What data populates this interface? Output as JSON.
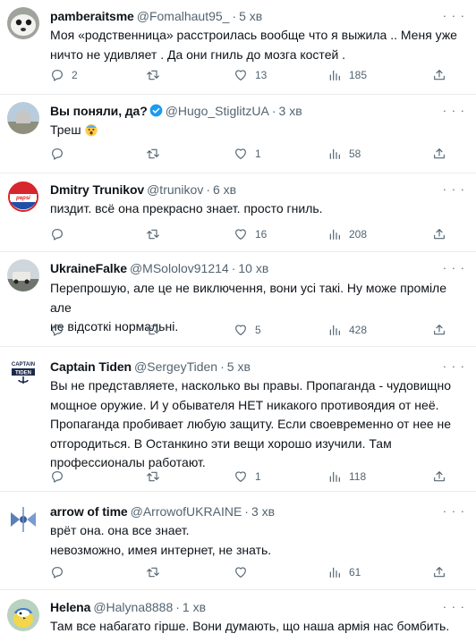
{
  "tweets": [
    {
      "name": "pamberaitsme",
      "handle": "@Fomalhaut95_",
      "time": "5 хв",
      "lines": [
        "Моя «родственница»  расстроилась вообще что я выжила .. Меня  уже",
        "ничто не удивляет .  Да они гниль до мозга костей ."
      ],
      "replies": "2",
      "retweets": "",
      "likes": "13",
      "views": "185"
    },
    {
      "name": "Вы поняли, да?",
      "handle": "@Hugo_StiglitzUA",
      "time": "3 хв",
      "verified": true,
      "lines": [
        "Треш"
      ],
      "replies": "",
      "retweets": "",
      "likes": "1",
      "views": "58"
    },
    {
      "name": "Dmitry Trunikov",
      "handle": "@trunikov",
      "time": "6 хв",
      "lines": [
        "пиздит. всё она прекрасно знает. просто гниль."
      ],
      "replies": "",
      "retweets": "",
      "likes": "16",
      "views": "208"
    },
    {
      "name": "UkraineFalke",
      "handle": "@MSololov91214",
      "time": "10 хв",
      "lines": [
        "Перепрошую, але це не виключення, вони усі такі. Ну може проміле але",
        "не відсоткі нормальні."
      ],
      "replies": "",
      "retweets": "",
      "likes": "5",
      "views": "428"
    },
    {
      "name": "Captain Tiden",
      "handle": "@SergeyTiden",
      "time": "5 хв",
      "lines": [
        "Вы не представляете, насколько вы правы. Пропаганда - чудовищно",
        "мощное оружие. И у обывателя НЕТ никакого противоядия от неё.",
        "Пропаганда пробивает любую защиту. Если своевременно от нее не",
        "отгородиться. В Останкино эти вещи хорошо изучили. Там",
        "профессионалы работают."
      ],
      "replies": "",
      "retweets": "",
      "likes": "1",
      "views": "118"
    },
    {
      "name": "arrow of time",
      "handle": "@ArrowofUKRAINE",
      "time": "3 хв",
      "lines": [
        "врёт она. она все знает.",
        "невозможно, имея интернет, не знать."
      ],
      "replies": "",
      "retweets": "",
      "likes": "",
      "views": "61"
    },
    {
      "name": "Helena",
      "handle": "@Halyna8888",
      "time": "1 хв",
      "lines": [
        "Там все набагато гірше. Вони думають, що наша армія нас бомбить."
      ]
    }
  ],
  "more_label": "· · ·",
  "avatar_text": {
    "captain": "CAPTAIN",
    "tiden": "TIDEN"
  },
  "icons": {
    "reply": "reply-icon",
    "retweet": "retweet-icon",
    "like": "heart-icon",
    "views": "views-icon",
    "share": "share-icon",
    "verified": "verified-badge-icon",
    "emoji": "scared-face-emoji"
  },
  "colors": {
    "text": "#0f1419",
    "secondary": "#536471",
    "divider": "#e8ecee",
    "verified": "#1d9bf0"
  }
}
